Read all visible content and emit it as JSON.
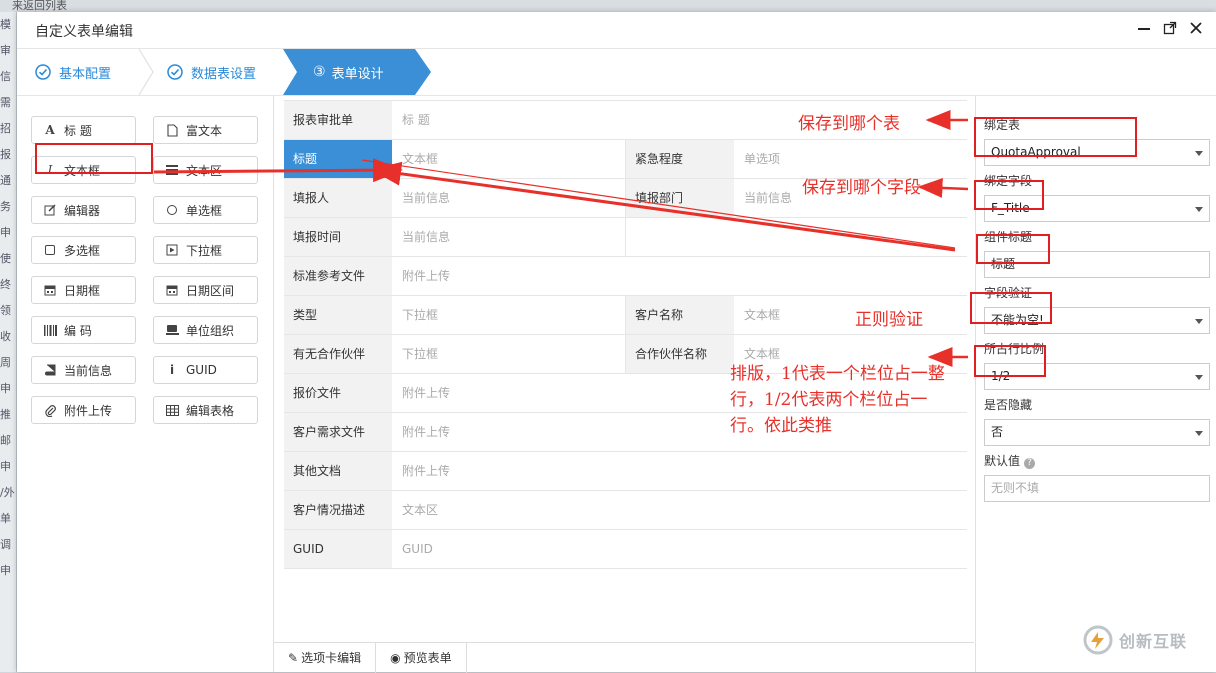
{
  "background": {
    "top_text": "来返回列表",
    "left_items": [
      "模",
      "审",
      "信",
      "需",
      "招",
      "报",
      "通",
      "务",
      "申",
      "使",
      "终",
      "领",
      "收",
      "周",
      "申",
      "推",
      "邮",
      "申",
      "/外",
      "单",
      "调",
      "申"
    ]
  },
  "dialog": {
    "title": "自定义表单编辑",
    "window_buttons": [
      "minimize-icon",
      "maximize-icon",
      "close-icon"
    ]
  },
  "steps": [
    {
      "label": "基本配置",
      "state": "done"
    },
    {
      "label": "数据表设置",
      "state": "done"
    },
    {
      "label": "表单设计",
      "number": "③",
      "state": "active"
    }
  ],
  "colors": {
    "accent": "#3a8fd6",
    "annotation": "#e8302a"
  },
  "palette": [
    {
      "label": "标 题",
      "icon": "A"
    },
    {
      "label": "富文本",
      "icon": "doc-icon"
    },
    {
      "label": "文本框",
      "icon": "I"
    },
    {
      "label": "文本区",
      "icon": "list-icon"
    },
    {
      "label": "编辑器",
      "icon": "edit-icon"
    },
    {
      "label": "单选框",
      "icon": "radio-icon"
    },
    {
      "label": "多选框",
      "icon": "checkbox-icon"
    },
    {
      "label": "下拉框",
      "icon": "dropdown-icon"
    },
    {
      "label": "日期框",
      "icon": "calendar-icon"
    },
    {
      "label": "日期区间",
      "icon": "calendar-icon"
    },
    {
      "label": "编 码",
      "icon": "barcode-icon"
    },
    {
      "label": "单位组织",
      "icon": "org-icon"
    },
    {
      "label": "当前信息",
      "icon": "book-icon"
    },
    {
      "label": "GUID",
      "icon": "i"
    },
    {
      "label": "附件上传",
      "icon": "paperclip-icon"
    },
    {
      "label": "编辑表格",
      "icon": "table-icon"
    }
  ],
  "form_rows": [
    {
      "cells": [
        {
          "label": "报表审批单",
          "value": "标 题"
        }
      ]
    },
    {
      "cells": [
        {
          "label": "标题",
          "value": "文本框",
          "selected": true
        },
        {
          "label": "紧急程度",
          "value": "单选项"
        }
      ]
    },
    {
      "cells": [
        {
          "label": "填报人",
          "value": "当前信息"
        },
        {
          "label": "填报部门",
          "value": "当前信息"
        }
      ]
    },
    {
      "cells": [
        {
          "label": "填报时间",
          "value": "当前信息"
        },
        {
          "label": "",
          "value": "",
          "blank": true
        }
      ]
    },
    {
      "cells": [
        {
          "label": "标准参考文件",
          "value": "附件上传"
        }
      ]
    },
    {
      "cells": [
        {
          "label": "类型",
          "value": "下拉框"
        },
        {
          "label": "客户名称",
          "value": "文本框"
        }
      ]
    },
    {
      "cells": [
        {
          "label": "有无合作伙伴",
          "value": "下拉框"
        },
        {
          "label": "合作伙伴名称",
          "value": "文本框"
        }
      ]
    },
    {
      "cells": [
        {
          "label": "报价文件",
          "value": "附件上传"
        }
      ]
    },
    {
      "cells": [
        {
          "label": "客户需求文件",
          "value": "附件上传"
        }
      ]
    },
    {
      "cells": [
        {
          "label": "其他文档",
          "value": "附件上传"
        }
      ]
    },
    {
      "cells": [
        {
          "label": "客户情况描述",
          "value": "文本区"
        }
      ]
    },
    {
      "cells": [
        {
          "label": "GUID",
          "value": "GUID"
        }
      ]
    }
  ],
  "bottom_tabs": [
    {
      "label": "选项卡编辑",
      "icon": "edit-icon"
    },
    {
      "label": "预览表单",
      "icon": "eye-icon"
    }
  ],
  "props": {
    "bind_table": {
      "label": "绑定表",
      "value": "QuotaApproval"
    },
    "bind_field": {
      "label": "绑定字段",
      "value": "F_Title"
    },
    "comp_title": {
      "label": "组件标题",
      "value": "标题"
    },
    "validate": {
      "label": "字段验证",
      "value": "不能为空!"
    },
    "ratio": {
      "label": "所占行比例",
      "value": "1/2"
    },
    "hidden": {
      "label": "是否隐藏",
      "value": "否"
    },
    "default": {
      "label": "默认值",
      "placeholder": "无则不填"
    }
  },
  "annotations": {
    "save_table": "保存到哪个表",
    "save_field": "保存到哪个字段",
    "regex": "正则验证",
    "layout": "排版，1代表一个栏位占一整行，1/2代表两个栏位占一行。依此类推"
  },
  "watermark": "创新互联"
}
